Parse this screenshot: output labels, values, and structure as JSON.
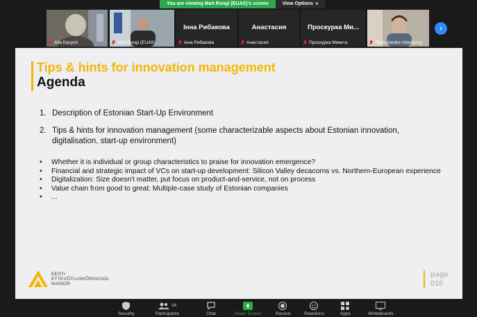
{
  "banner": {
    "message": "You are viewing Mait Rungi (EUAS)'s screen",
    "view_options": "View Options"
  },
  "participants": [
    {
      "name": "Alla Kasych",
      "display": ""
    },
    {
      "name": "Mait Rungi (EUAS)",
      "display": ""
    },
    {
      "name": "Інна Рибакова",
      "display": "Інна Рибакова"
    },
    {
      "name": "Анастасия",
      "display": "Анастасия"
    },
    {
      "name": "Проскурка Микита",
      "display": "Проскурка Ми..."
    },
    {
      "name": "Tymoshenko Volodymyr",
      "display": ""
    }
  ],
  "slide": {
    "title": "Tips & hints for innovation management",
    "subtitle": "Agenda",
    "numbered": [
      {
        "n": "1.",
        "text": "Description of Estonian Start-Up Environment"
      },
      {
        "n": "2.",
        "text": "Tips & hints for innovation management (some characterizable aspects about Estonian innovation, digitalisation, start-up environment)"
      }
    ],
    "bullets": [
      "Whether it is individual or group characteristics to praise for innovation emergence?",
      "Financial and strategic impact of VCs on start-up development: Silicon Valley decacorns vs. Northern-European experience",
      "Digitalization: Size doesn't matter, put focus on product-and-service, not on process",
      "Value chain from good to great: Multiple-case study of Estonian companies",
      "..."
    ],
    "logo_lines": [
      "EESTI",
      "ETTEVÕTLUSKÕRGKOOL",
      "MAINOR"
    ],
    "page_label": "page",
    "page_number": "010"
  },
  "toolbar": {
    "security": "Security",
    "participants": "Participants",
    "participants_count": "34",
    "chat": "Chat",
    "share": "Share Screen",
    "record": "Record",
    "reactions": "Reactions",
    "apps": "Apps",
    "whiteboards": "Whiteboards"
  },
  "left_edge": "eo",
  "colors": {
    "accent": "#f2b705",
    "share_green": "#2da84a",
    "next_blue": "#2d8cff",
    "muted_red": "#e02828"
  }
}
